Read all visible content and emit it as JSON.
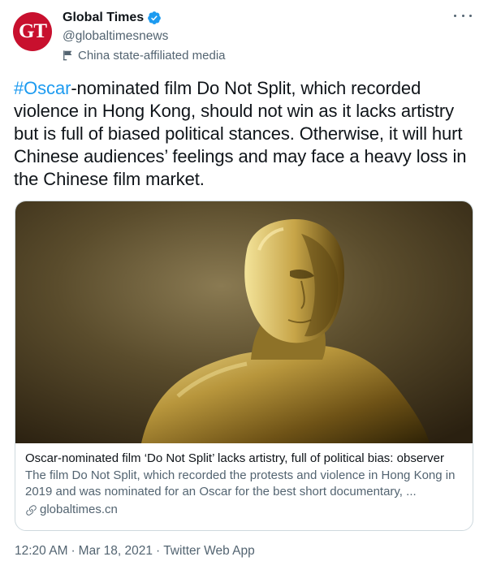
{
  "account": {
    "avatar_text": "GT",
    "name": "Global Times",
    "handle": "@globaltimesnews",
    "affiliation": "China state-affiliated media",
    "verified_icon": "verified-badge-icon",
    "affiliation_icon": "state-media-flag-icon"
  },
  "tweet": {
    "hashtag": "#Oscar",
    "text": "-nominated film Do Not Split, which recorded violence in Hong Kong, should not win as it lacks artistry but is full of biased political stances. Otherwise, it will hurt Chinese audiences’ feelings and may face a heavy loss in the Chinese film market."
  },
  "card": {
    "title": "Oscar-nominated film ‘Do Not Split’ lacks artistry, full of political bias: observer",
    "description": "The film Do Not Split, which recorded the protests and violence in Hong Kong in 2019 and was nominated for an Oscar for the best short documentary, ...",
    "domain": "globaltimes.cn",
    "link_icon": "link-icon",
    "image_subject": "oscar-statue-image"
  },
  "meta": {
    "time": "12:20 AM",
    "separator": "·",
    "date": "Mar 18, 2021",
    "source": "Twitter Web App"
  },
  "colors": {
    "accent": "#1d9bf0",
    "secondary_text": "#536471",
    "avatar_bg": "#c8102e",
    "border": "#cfd9de"
  }
}
